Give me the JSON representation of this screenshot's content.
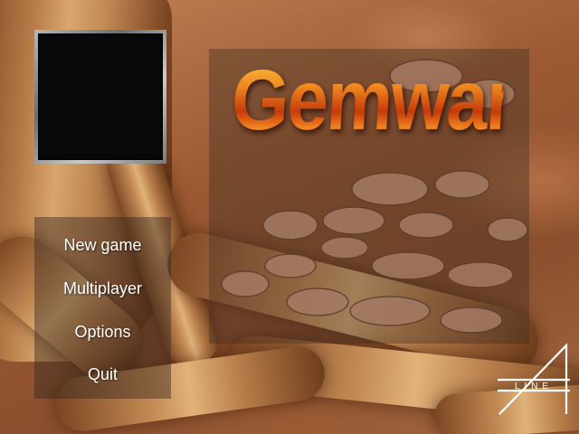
{
  "game": {
    "title": "Gemwars"
  },
  "menu": {
    "items": [
      {
        "label": "New game"
      },
      {
        "label": "Multiplayer"
      },
      {
        "label": "Options"
      },
      {
        "label": "Quit"
      }
    ]
  },
  "studio_logo": {
    "text": "LINE"
  },
  "colors": {
    "title_fire": "#e06a14",
    "menu_text": "#ffffff",
    "preview_bg": "#090909"
  }
}
